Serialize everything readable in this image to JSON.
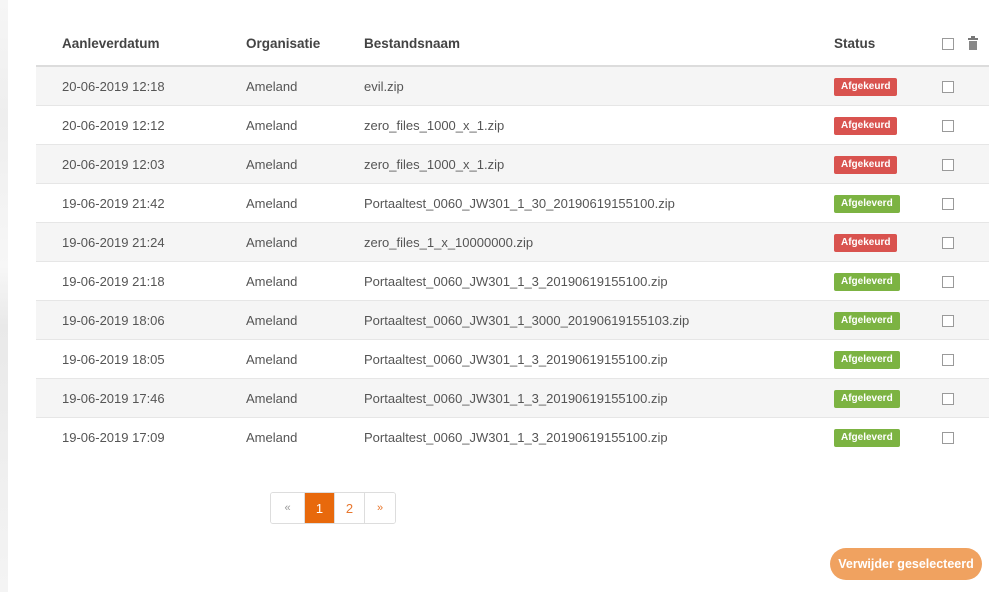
{
  "table": {
    "headers": {
      "date": "Aanleverdatum",
      "organization": "Organisatie",
      "filename": "Bestandsnaam",
      "status": "Status"
    },
    "rows": [
      {
        "date": "20-06-2019 12:18",
        "organization": "Ameland",
        "filename": "evil.zip",
        "status": "Afgekeurd",
        "status_type": "rejected"
      },
      {
        "date": "20-06-2019 12:12",
        "organization": "Ameland",
        "filename": "zero_files_1000_x_1.zip",
        "status": "Afgekeurd",
        "status_type": "rejected"
      },
      {
        "date": "20-06-2019 12:03",
        "organization": "Ameland",
        "filename": "zero_files_1000_x_1.zip",
        "status": "Afgekeurd",
        "status_type": "rejected"
      },
      {
        "date": "19-06-2019 21:42",
        "organization": "Ameland",
        "filename": "Portaaltest_0060_JW301_1_30_20190619155100.zip",
        "status": "Afgeleverd",
        "status_type": "delivered"
      },
      {
        "date": "19-06-2019 21:24",
        "organization": "Ameland",
        "filename": "zero_files_1_x_10000000.zip",
        "status": "Afgekeurd",
        "status_type": "rejected"
      },
      {
        "date": "19-06-2019 21:18",
        "organization": "Ameland",
        "filename": "Portaaltest_0060_JW301_1_3_20190619155100.zip",
        "status": "Afgeleverd",
        "status_type": "delivered"
      },
      {
        "date": "19-06-2019 18:06",
        "organization": "Ameland",
        "filename": "Portaaltest_0060_JW301_1_3000_20190619155103.zip",
        "status": "Afgeleverd",
        "status_type": "delivered"
      },
      {
        "date": "19-06-2019 18:05",
        "organization": "Ameland",
        "filename": "Portaaltest_0060_JW301_1_3_20190619155100.zip",
        "status": "Afgeleverd",
        "status_type": "delivered"
      },
      {
        "date": "19-06-2019 17:46",
        "organization": "Ameland",
        "filename": "Portaaltest_0060_JW301_1_3_20190619155100.zip",
        "status": "Afgeleverd",
        "status_type": "delivered"
      },
      {
        "date": "19-06-2019 17:09",
        "organization": "Ameland",
        "filename": "Portaaltest_0060_JW301_1_3_20190619155100.zip",
        "status": "Afgeleverd",
        "status_type": "delivered"
      }
    ]
  },
  "pagination": {
    "prev_label": "«",
    "pages": [
      "1",
      "2"
    ],
    "current": "1",
    "next_label": "»"
  },
  "actions": {
    "delete_selected_label": "Verwijder geselecteerd"
  },
  "icons": {
    "header_trash": "trash-icon",
    "select_all": "checkbox"
  },
  "colors": {
    "rejected": "#d9534f",
    "delivered": "#7cb342",
    "accent": "#e8690c",
    "delete_button": "#f0a260"
  }
}
